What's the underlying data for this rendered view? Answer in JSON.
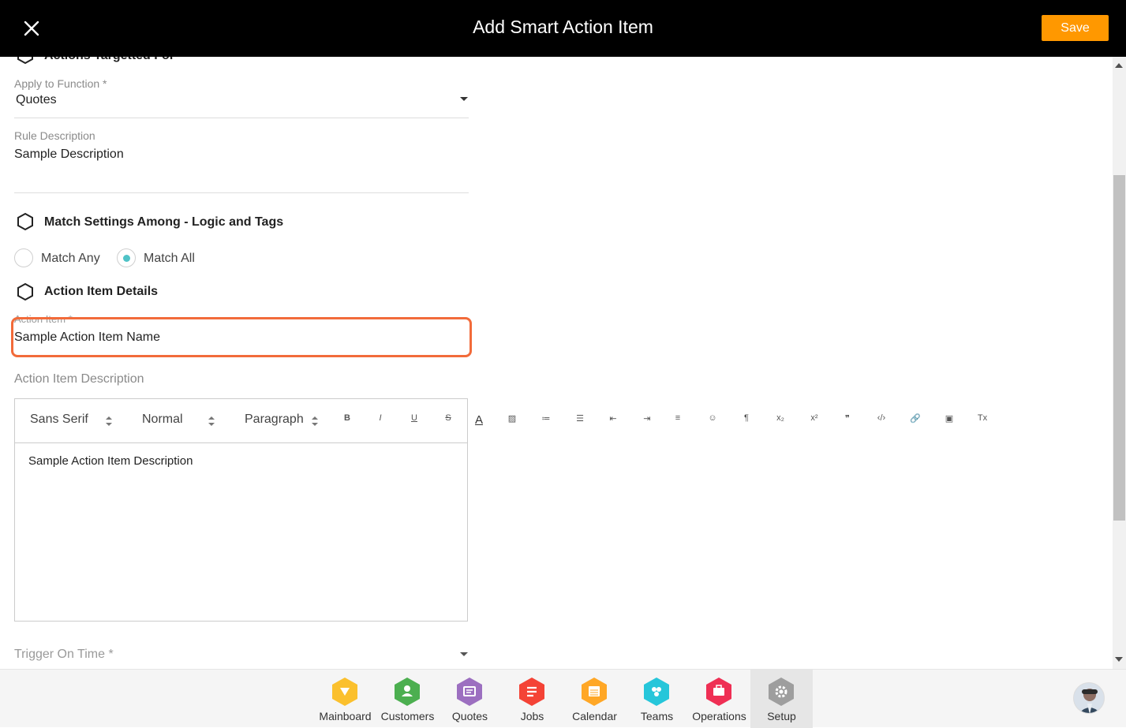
{
  "header": {
    "title": "Add Smart Action Item",
    "save_label": "Save"
  },
  "form": {
    "partial_section_title": "Actions Targetted For",
    "apply_function_label": "Apply to Function *",
    "apply_function_value": "Quotes",
    "rule_description_label": "Rule Description",
    "rule_description_value": "Sample Description",
    "match_section_title": "Match Settings Among - Logic and Tags",
    "match_any_label": "Match Any",
    "match_all_label": "Match All",
    "match_selected": "Match All",
    "details_section_title": "Action Item Details",
    "action_item_label": "Action Item *",
    "action_item_value": "Sample Action Item Name",
    "description_label": "Action Item Description",
    "trigger_label": "Trigger On Time *"
  },
  "editor": {
    "font_select": "Sans Serif",
    "size_select": "Normal",
    "block_select": "Paragraph",
    "content": "Sample Action Item Description",
    "tools": [
      {
        "name": "bold-icon",
        "glyph": "B"
      },
      {
        "name": "italic-icon",
        "glyph": "I"
      },
      {
        "name": "underline-icon",
        "glyph": "U"
      },
      {
        "name": "strike-icon",
        "glyph": "S"
      },
      {
        "name": "text-color-icon",
        "glyph": "A"
      },
      {
        "name": "background-color-icon",
        "glyph": "▨"
      },
      {
        "name": "ordered-list-icon",
        "glyph": "≔"
      },
      {
        "name": "bullet-list-icon",
        "glyph": "☰"
      },
      {
        "name": "outdent-icon",
        "glyph": "⇤"
      },
      {
        "name": "indent-icon",
        "glyph": "⇥"
      },
      {
        "name": "align-icon",
        "glyph": "≡"
      },
      {
        "name": "emoji-icon",
        "glyph": "☺"
      },
      {
        "name": "text-direction-icon",
        "glyph": "¶"
      },
      {
        "name": "subscript-icon",
        "glyph": "x₂"
      },
      {
        "name": "superscript-icon",
        "glyph": "x²"
      },
      {
        "name": "blockquote-icon",
        "glyph": "❞"
      },
      {
        "name": "code-icon",
        "glyph": "‹/›"
      },
      {
        "name": "link-icon",
        "glyph": "🔗"
      },
      {
        "name": "image-icon",
        "glyph": "▣"
      },
      {
        "name": "clear-format-icon",
        "glyph": "Tx"
      }
    ]
  },
  "nav": {
    "items": [
      {
        "label": "Mainboard",
        "color": "#fbc02d",
        "icon": "mainboard-icon"
      },
      {
        "label": "Customers",
        "color": "#4caf50",
        "icon": "customers-icon"
      },
      {
        "label": "Quotes",
        "color": "#9c6fc0",
        "icon": "quotes-icon"
      },
      {
        "label": "Jobs",
        "color": "#f44336",
        "icon": "jobs-icon"
      },
      {
        "label": "Calendar",
        "color": "#ffa726",
        "icon": "calendar-icon"
      },
      {
        "label": "Teams",
        "color": "#26c6da",
        "icon": "teams-icon"
      },
      {
        "label": "Operations",
        "color": "#ef2f54",
        "icon": "operations-icon"
      },
      {
        "label": "Setup",
        "color": "#9e9e9e",
        "icon": "setup-icon"
      }
    ],
    "active": "Setup"
  }
}
